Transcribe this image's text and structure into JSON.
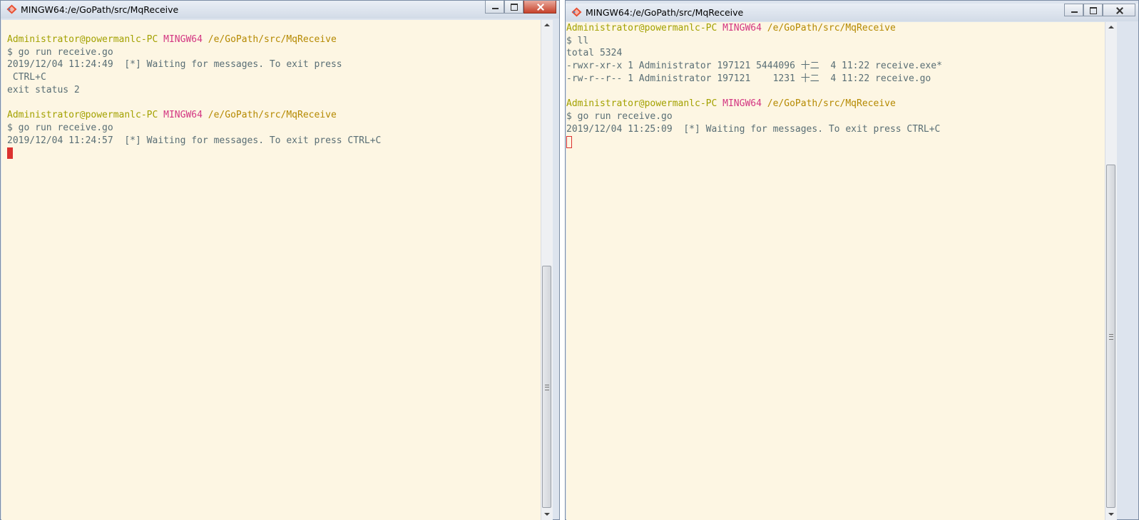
{
  "colors": {
    "terminal_bg": "#fdf6e3",
    "text": "#596e75",
    "user_host": "#a3a100",
    "mingw": "#d33682",
    "path": "#b58900",
    "cursor": "#dc322f"
  },
  "left_window": {
    "title": "MINGW64:/e/GoPath/src/MqReceive",
    "icon": "git-bash-icon",
    "prompt1": {
      "user": "Administrator@powermanlc-PC",
      "system": "MINGW64",
      "path": "/e/GoPath/src/MqReceive"
    },
    "cmd1": "$ go run receive.go",
    "out1a": "2019/12/04 11:24:49  [*] Waiting for messages. To exit press",
    "out1b": " CTRL+C",
    "out1c": "exit status 2",
    "prompt2": {
      "user": "Administrator@powermanlc-PC",
      "system": "MINGW64",
      "path": "/e/GoPath/src/MqReceive"
    },
    "cmd2": "$ go run receive.go",
    "out2": "2019/12/04 11:24:57  [*] Waiting for messages. To exit press CTRL+C"
  },
  "right_window": {
    "title": "MINGW64:/e/GoPath/src/MqReceive",
    "icon": "git-bash-icon",
    "prompt1": {
      "user": "Administrator@powermanlc-PC",
      "system": "MINGW64",
      "path": "/e/GoPath/src/MqReceive"
    },
    "cmd1": "$ ll",
    "out1a": "total 5324",
    "out1b": "-rwxr-xr-x 1 Administrator 197121 5444096 十二  4 11:22 receive.exe*",
    "out1c": "-rw-r--r-- 1 Administrator 197121    1231 十二  4 11:22 receive.go",
    "prompt2": {
      "user": "Administrator@powermanlc-PC",
      "system": "MINGW64",
      "path": "/e/GoPath/src/MqReceive"
    },
    "cmd2": "$ go run receive.go",
    "out2": "2019/12/04 11:25:09  [*] Waiting for messages. To exit press CTRL+C"
  }
}
